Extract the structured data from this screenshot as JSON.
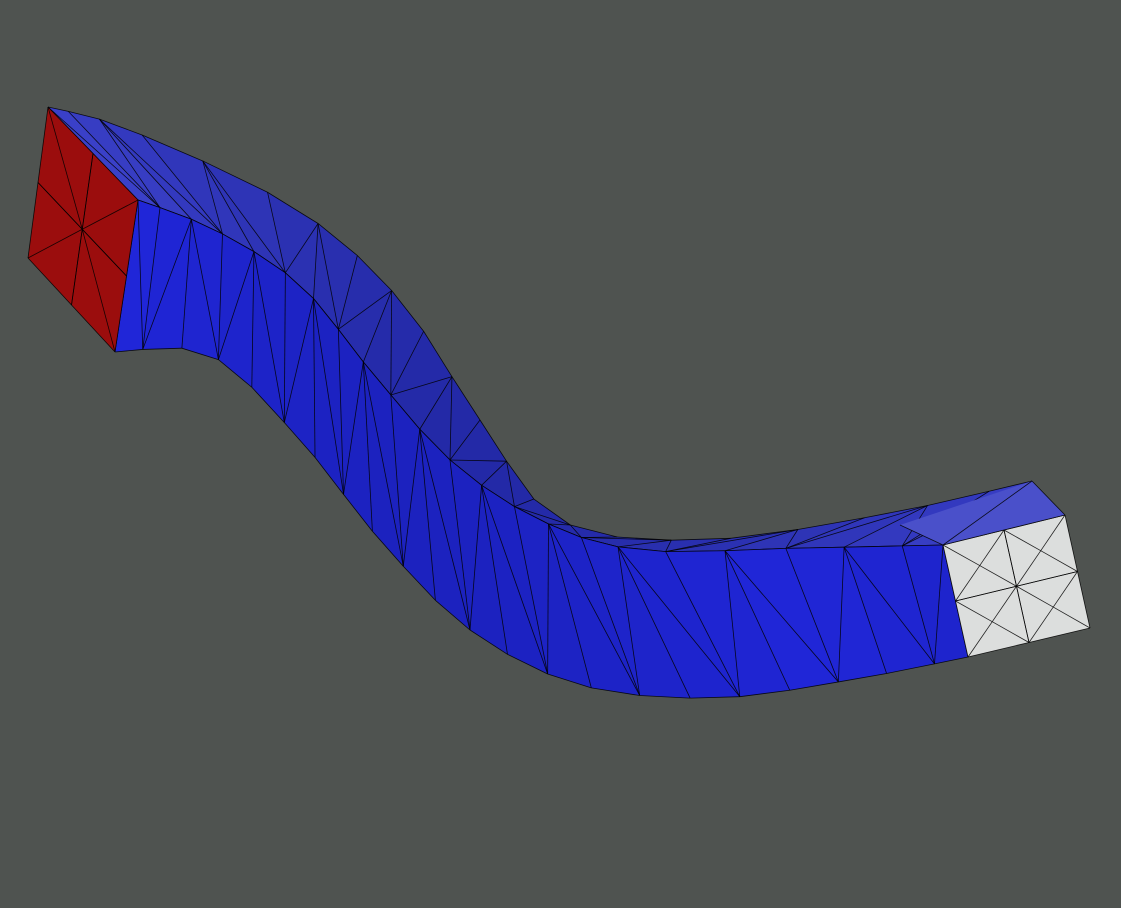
{
  "viewport": {
    "background_color": "#4f5350"
  },
  "mesh": {
    "element_type": "triangle",
    "edge_color": "#000000",
    "colors": {
      "fixed_end_face": "#9b0d0d",
      "free_end_face": "#dcdedd",
      "top_surface": "#3a40c8",
      "side_surface_light": "#2026d8",
      "side_surface_mid": "#1a20b4",
      "side_surface_dark": "#10168c",
      "inner_surface": "#141aa0"
    }
  }
}
